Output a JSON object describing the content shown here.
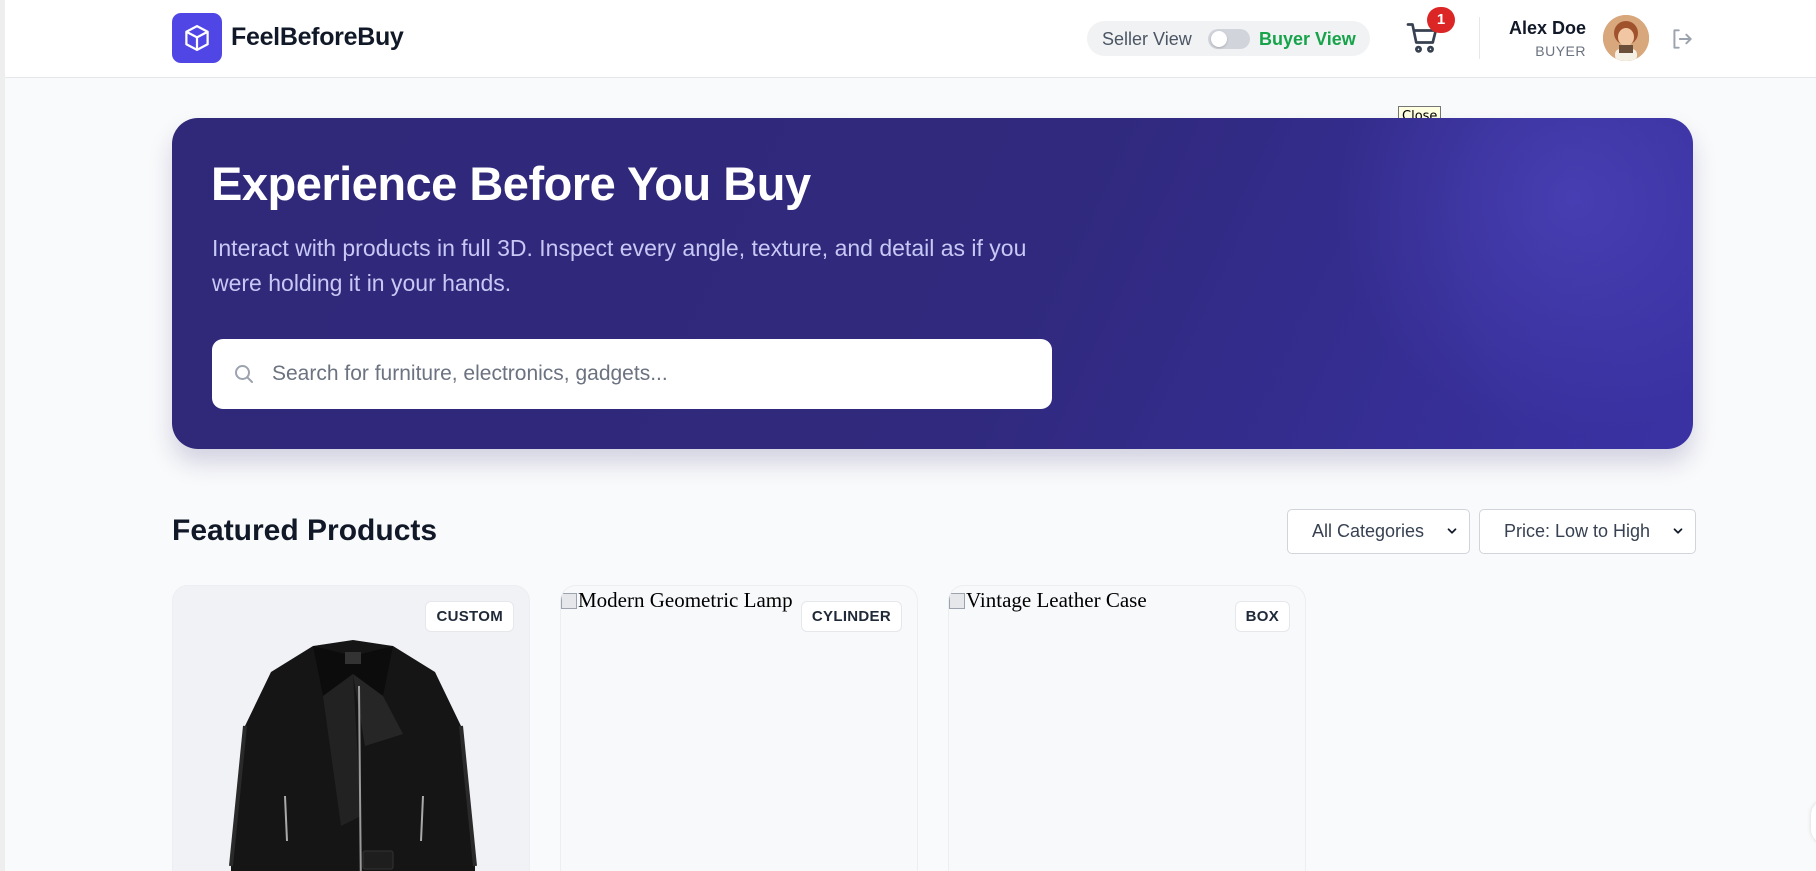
{
  "header": {
    "brand": "FeelBeforeBuy",
    "seller_view_label": "Seller View",
    "buyer_view_label": "Buyer View",
    "view_mode": "buyer",
    "cart_count": "1",
    "user_name": "Alex Doe",
    "user_role": "BUYER"
  },
  "tooltip": "Close",
  "hero": {
    "title": "Experience Before You Buy",
    "subtitle": "Interact with products in full 3D. Inspect every angle, texture, and detail as if you were holding it in your hands.",
    "search_placeholder": "Search for furniture, electronics, gadgets...",
    "search_value": ""
  },
  "featured": {
    "title": "Featured Products",
    "category_filter": "All Categories",
    "sort_filter": "Price: Low to High",
    "products": [
      {
        "alt": "",
        "tag": "CUSTOM"
      },
      {
        "alt": "Modern Geometric Lamp",
        "tag": "CYLINDER"
      },
      {
        "alt": "Vintage Leather Case",
        "tag": "BOX"
      }
    ]
  },
  "colors": {
    "accent": "#5046e5",
    "hero_bg": "#302878",
    "buyer_green": "#16a34a",
    "badge_red": "#dc2626"
  }
}
